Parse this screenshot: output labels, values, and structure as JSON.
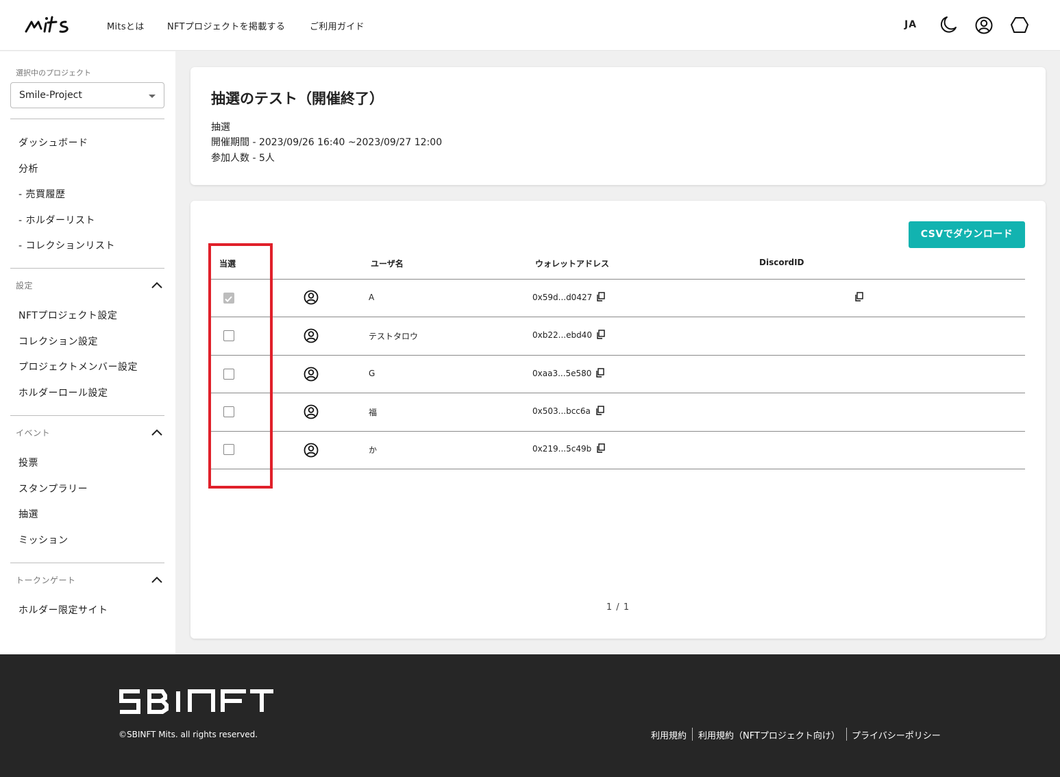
{
  "header": {
    "logo_text": "mits",
    "nav": [
      "Mitsとは",
      "NFTプロジェクトを掲載する",
      "ご利用ガイド"
    ],
    "lang": "JA",
    "icons": [
      "moon-icon",
      "account-icon",
      "wallet-icon"
    ]
  },
  "sidebar": {
    "project_caption": "選択中のプロジェクト",
    "project_value": "Smile-Project",
    "main_links": [
      "ダッシュボード",
      "分析",
      "- 売買履歴",
      "- ホルダーリスト",
      "- コレクションリスト"
    ],
    "settings": {
      "title": "設定",
      "links": [
        "NFTプロジェクト設定",
        "コレクション設定",
        "プロジェクトメンバー設定",
        "ホルダーロール設定"
      ]
    },
    "events": {
      "title": "イベント",
      "links": [
        "投票",
        "スタンプラリー",
        "抽選",
        "ミッション"
      ]
    },
    "token_gate": {
      "title": "トークンゲート",
      "links": [
        "ホルダー限定サイト"
      ]
    }
  },
  "event": {
    "title": "抽選のテスト（開催終了）",
    "type": "抽選",
    "period": "開催期間 - 2023/09/26 16:40 ~2023/09/27 12:00",
    "participants": "参加人数 - 5人"
  },
  "table": {
    "csv_button": "CSVでダウンロード",
    "headers": {
      "winner": "当選",
      "username": "ユーザ名",
      "wallet": "ウォレットアドレス",
      "discord": "DiscordID"
    },
    "rows": [
      {
        "winner": true,
        "username": "A",
        "wallet": "0x59d...d0427",
        "discord_copy": true
      },
      {
        "winner": false,
        "username": "テストタロウ",
        "wallet": "0xb22...ebd40",
        "discord_copy": false
      },
      {
        "winner": false,
        "username": "G",
        "wallet": "0xaa3...5e580",
        "discord_copy": false
      },
      {
        "winner": false,
        "username": "福",
        "wallet": "0x503...bcc6a",
        "discord_copy": false
      },
      {
        "winner": false,
        "username": "か",
        "wallet": "0x219...5c49b",
        "discord_copy": false
      }
    ],
    "pager": "1 / 1"
  },
  "footer": {
    "brand": "SBINFT",
    "copyright": "©SBINFT Mits. all rights reserved.",
    "links": [
      "利用規約",
      "利用規約（NFTプロジェクト向け）",
      "プライバシーポリシー"
    ]
  },
  "colors": {
    "accent": "#12b3b0",
    "highlight": "#e0202a",
    "footer_bg": "#262626"
  }
}
